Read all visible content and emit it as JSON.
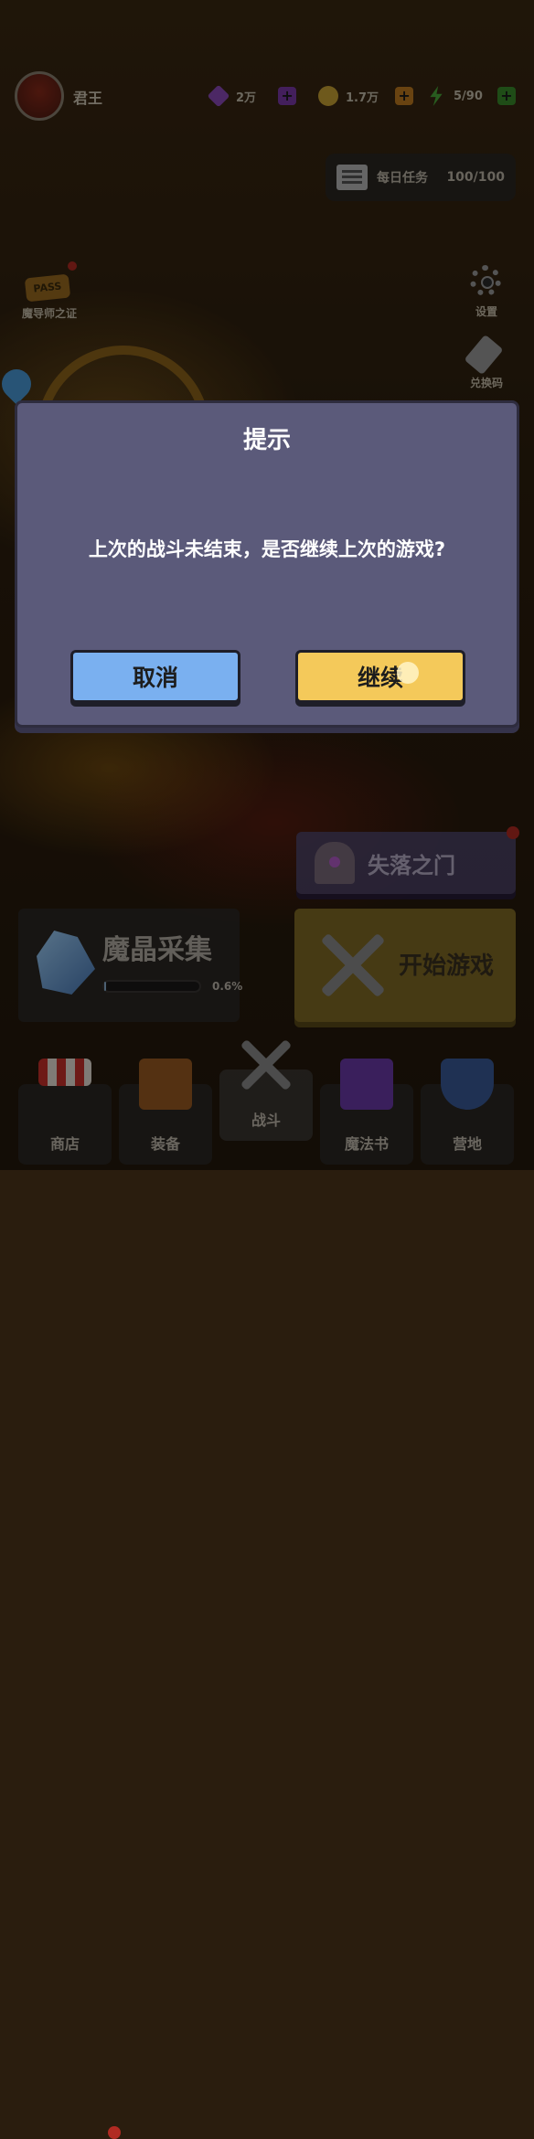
{
  "player": {
    "name": "君王"
  },
  "resources": [
    {
      "icon": "purple-gem-icon",
      "value": "2万",
      "color": "#8a4ab8"
    },
    {
      "icon": "gold-coin-icon",
      "value": "1.7万",
      "color": "#c9a233"
    },
    {
      "icon": "energy-bolt-icon",
      "value": "5/90",
      "color": "#4aa83a"
    }
  ],
  "daily_task": {
    "label": "每日任务",
    "progress": "100/100"
  },
  "side": {
    "pass_badge": "PASS",
    "pass_label": "魔导师之证",
    "settings_label": "设置",
    "redeem_label": "兑换码"
  },
  "dialog": {
    "title": "提示",
    "message": "上次的战斗未结束，是否继续上次的游戏?",
    "cancel_label": "取消",
    "continue_label": "继续"
  },
  "panels": {
    "lost_door_label": "失落之门",
    "crystal_label": "魔晶采集",
    "crystal_progress": "0.6%",
    "crystal_fraction": 0.006,
    "start_label": "开始游戏"
  },
  "nav": [
    {
      "label": "商店"
    },
    {
      "label": "装备"
    },
    {
      "label": "战斗"
    },
    {
      "label": "魔法书"
    },
    {
      "label": "营地"
    }
  ]
}
